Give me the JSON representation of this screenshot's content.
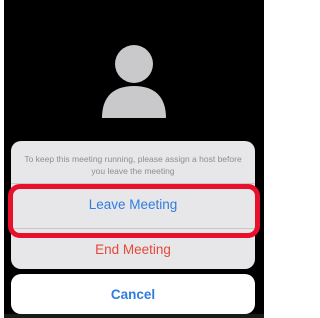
{
  "dialog": {
    "message": "To keep this meeting running, please assign a host before you leave the meeting",
    "leave_label": "Leave Meeting",
    "end_label": "End Meeting",
    "cancel_label": "Cancel"
  },
  "colors": {
    "action_blue": "#2f7ddf",
    "destructive_red": "#e5493a",
    "highlight_red": "#e8102a",
    "background": "#000000"
  },
  "icons": {
    "avatar": "person-silhouette-icon"
  }
}
